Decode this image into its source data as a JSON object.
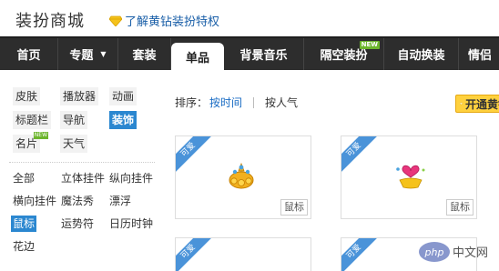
{
  "header": {
    "site_title": "装扮商城",
    "promo_text": "了解黄钻装扮特权",
    "gem_color": "#f5c21b"
  },
  "nav": {
    "items": [
      {
        "label": "首页"
      },
      {
        "label": "专题",
        "has_dropdown": true
      },
      {
        "label": "套装"
      },
      {
        "label": "单品",
        "active": true
      },
      {
        "label": "背景音乐"
      },
      {
        "label": "隔空装扮",
        "badge": "NEW"
      },
      {
        "label": "自动换装"
      },
      {
        "label": "情侣"
      }
    ]
  },
  "sidebar": {
    "categories": [
      {
        "label": "皮肤"
      },
      {
        "label": "播放器"
      },
      {
        "label": "动画"
      },
      {
        "label": "标题栏"
      },
      {
        "label": "导航"
      },
      {
        "label": "装饰",
        "selected": true
      },
      {
        "label": "名片",
        "badge": "NEW"
      },
      {
        "label": "天气"
      }
    ],
    "subcategories": [
      {
        "label": "全部"
      },
      {
        "label": "立体挂件"
      },
      {
        "label": "纵向挂件"
      },
      {
        "label": "横向挂件"
      },
      {
        "label": "魔法秀"
      },
      {
        "label": "漂浮"
      },
      {
        "label": "鼠标",
        "selected": true
      },
      {
        "label": "运势符"
      },
      {
        "label": "日历时钟"
      },
      {
        "label": "花边"
      }
    ]
  },
  "main": {
    "sort_label": "排序：",
    "sort_by_time": "按时间",
    "sort_by_popularity": "按人气",
    "open_button": "开通黄钻",
    "cards": [
      {
        "ribbon": "可爱",
        "tag": "鼠标",
        "thumb_icon": "golden-crown-icon"
      },
      {
        "ribbon": "可爱",
        "tag": "鼠标",
        "thumb_icon": "heart-ingot-icon"
      },
      {
        "ribbon": "可爱",
        "tag": "",
        "thumb_icon": "partial-icon"
      },
      {
        "ribbon": "可爱",
        "tag": "",
        "thumb_icon": "partial-icon"
      }
    ]
  },
  "colors": {
    "nav_bg": "#2d2d2d",
    "accent_blue": "#2b87d0",
    "link_blue": "#1a6cc4",
    "ribbon_blue": "#4a93d9",
    "new_green": "#6cb52c",
    "button_yellow": "#ffd13e"
  }
}
